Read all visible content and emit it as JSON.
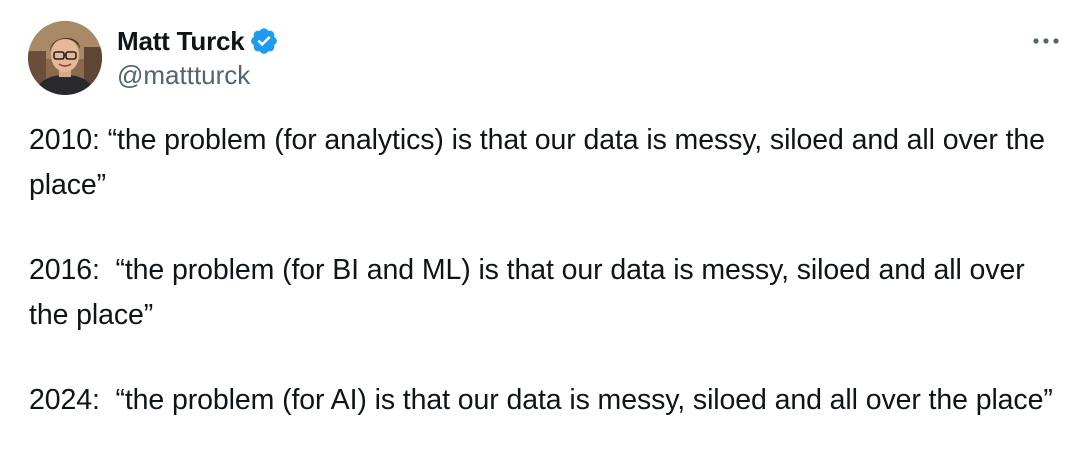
{
  "author": {
    "display_name": "Matt Turck",
    "handle": "@mattturck",
    "verified": true,
    "verified_badge_color": "#1d9bf0"
  },
  "more_icon": "more-horizontal-icon",
  "tweet": {
    "paragraphs": [
      "2010: “the problem (for analytics) is that our data is messy, siloed and all over the place”",
      "2016:  “the problem (for BI and ML) is that our data is messy, siloed and all over the place”",
      "2024:  “the problem (for AI) is that our data is messy, siloed and all over the place”"
    ]
  }
}
